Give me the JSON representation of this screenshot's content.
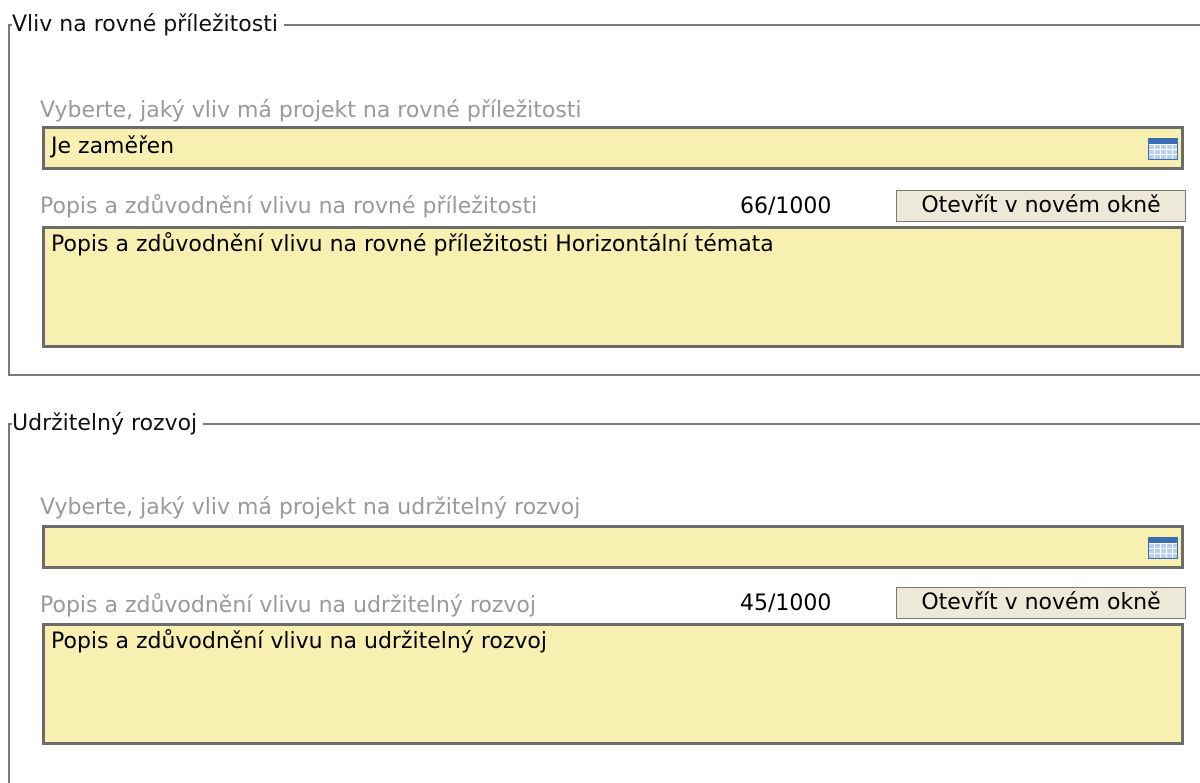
{
  "section_equal_opportunities": {
    "legend": "Vliv na rovné příležitosti",
    "select_label": "Vyberte, jaký vliv má projekt na rovné příležitosti",
    "select_value": "Je zaměřen",
    "description_label": "Popis a zdůvodnění vlivu na rovné příležitosti",
    "counter": "66/1000",
    "open_button": "Otevřít v novém okně",
    "description_value": "Popis a zdůvodnění vlivu na rovné příležitosti Horizontální témata"
  },
  "section_sustainable_development": {
    "legend": "Udržitelný rozvoj",
    "select_label": "Vyberte, jaký vliv má projekt na udržitelný rozvoj",
    "select_value": "",
    "description_label": "Popis a zdůvodnění vlivu na udržitelný rozvoj",
    "counter": "45/1000",
    "open_button": "Otevřít v novém okně",
    "description_value": "Popis a zdůvodnění vlivu na udržitelný rozvoj"
  },
  "icons": {
    "select_picker": "calendar-icon"
  },
  "colors": {
    "field_background": "#f8f0b0",
    "field_border": "#6b6b6b",
    "label_text": "#9a9a9a",
    "button_background": "#ece9d8"
  }
}
